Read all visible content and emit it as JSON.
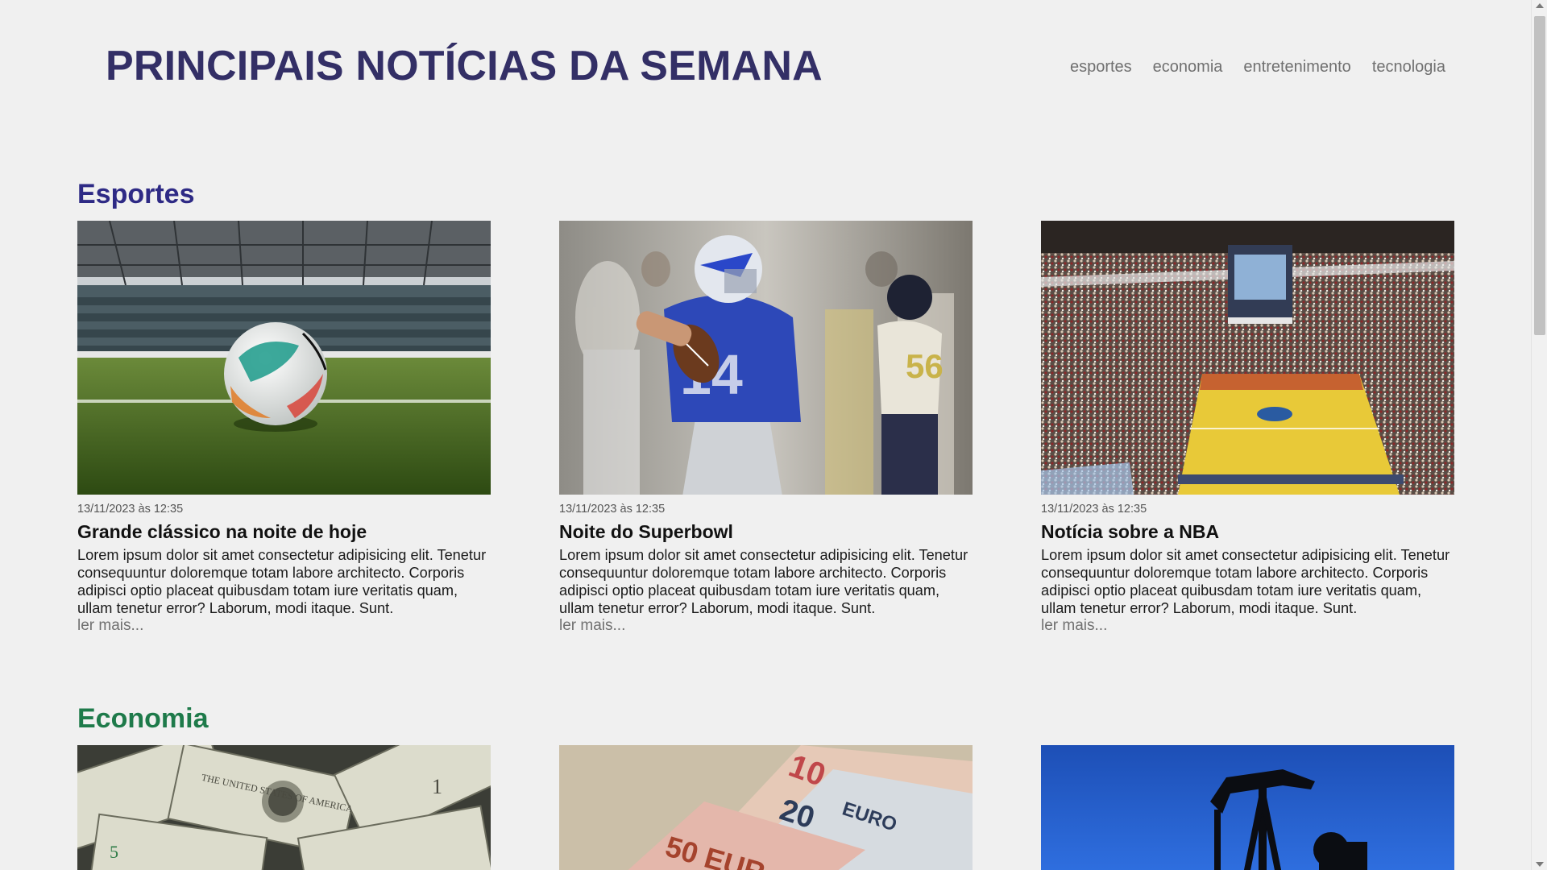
{
  "header": {
    "title": "PRINCIPAIS NOTÍCIAS DA SEMANA",
    "nav": [
      "esportes",
      "economia",
      "entretenimento",
      "tecnologia"
    ]
  },
  "sections": [
    {
      "title": "Esportes",
      "color": "#2e2a85",
      "articles": [
        {
          "image": "soccer-ball-stadium",
          "date": "13/11/2023 às 12:35",
          "headline": "Grande clássico na noite de hoje",
          "excerpt": "Lorem ipsum dolor sit amet consectetur adipisicing elit. Tenetur consequuntur doloremque totam labore architecto. Corporis adipisci optio placeat quibusdam totam iure veritatis quam, ullam tenetur error? Laborum, modi itaque. Sunt.",
          "more": "ler mais..."
        },
        {
          "image": "american-football-player",
          "date": "13/11/2023 às 12:35",
          "headline": "Noite do Superbowl",
          "excerpt": "Lorem ipsum dolor sit amet consectetur adipisicing elit. Tenetur consequuntur doloremque totam labore architecto. Corporis adipisci optio placeat quibusdam totam iure veritatis quam, ullam tenetur error? Laborum, modi itaque. Sunt.",
          "more": "ler mais..."
        },
        {
          "image": "basketball-arena",
          "date": "13/11/2023 às 12:35",
          "headline": "Notícia sobre a NBA",
          "excerpt": "Lorem ipsum dolor sit amet consectetur adipisicing elit. Tenetur consequuntur doloremque totam labore architecto. Corporis adipisci optio placeat quibusdam totam iure veritatis quam, ullam tenetur error? Laborum, modi itaque. Sunt.",
          "more": "ler mais..."
        }
      ]
    },
    {
      "title": "Economia",
      "color": "#1e7a4a",
      "articles": [
        {
          "image": "dollar-bills"
        },
        {
          "image": "euro-banknotes"
        },
        {
          "image": "oil-pump-silhouette"
        }
      ]
    }
  ]
}
